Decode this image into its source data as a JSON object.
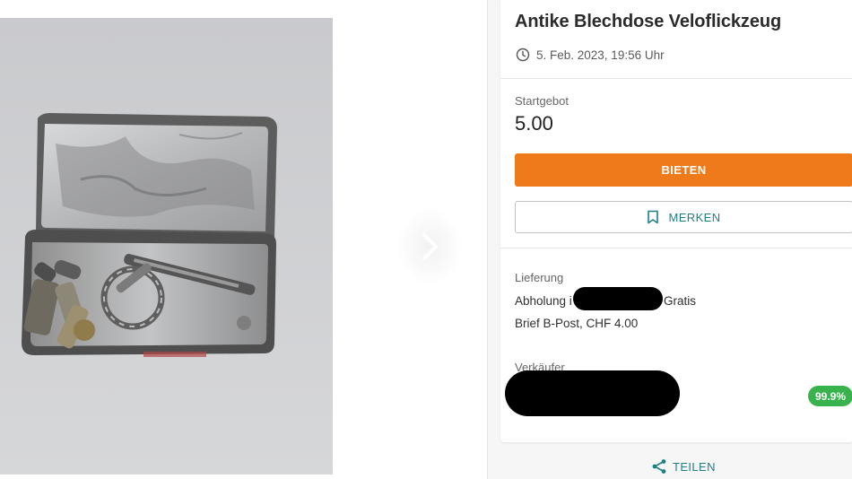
{
  "gallery": {
    "image_alt": "tin-box-photo",
    "next_icon": "chevron-right-icon"
  },
  "listing": {
    "title": "Antike Blechdose Veloflickzeug",
    "date": "5. Feb. 2023, 19:56 Uhr",
    "date_icon": "clock-icon"
  },
  "bid": {
    "label": "Startgebot",
    "price": "5.00",
    "bid_button": "BIETEN",
    "watch_button": "MERKEN",
    "watch_icon": "bookmark-icon"
  },
  "delivery": {
    "label": "Lieferung",
    "pickup_prefix": "Abholung i",
    "pickup_suffix": "Gratis",
    "post": "Brief B-Post, CHF 4.00"
  },
  "seller": {
    "label": "Verkäufer",
    "rating": "99.9%"
  },
  "share": {
    "label": "TEILEN",
    "icon": "share-icon"
  },
  "colors": {
    "accent_orange": "#ef7a1a",
    "accent_teal": "#1e7f87",
    "rating_green": "#37b24d"
  }
}
